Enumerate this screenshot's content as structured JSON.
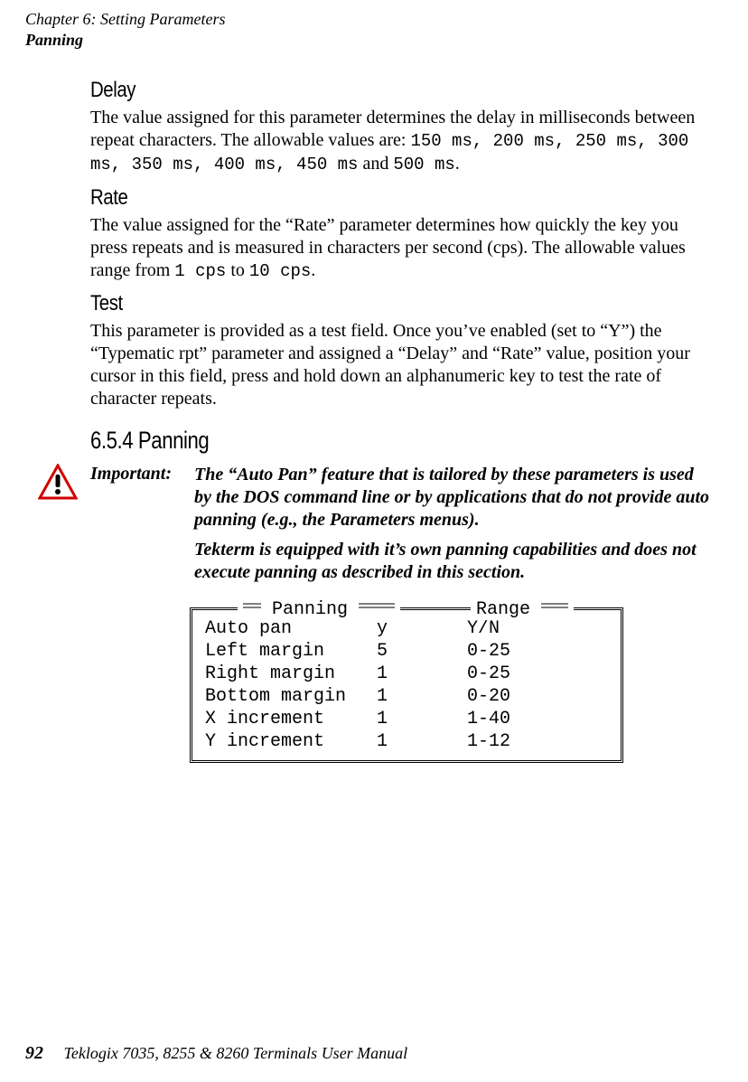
{
  "header": {
    "chapter": "Chapter  6:  Setting Parameters",
    "section": "Panning"
  },
  "delay": {
    "heading": "Delay",
    "body_pre": "The value assigned for this parameter determines the delay in milliseconds between repeat characters. The allowable values are: ",
    "mono1": "150 ms, 200 ms, 250 ms, 300 ms, 350 ms, 400 ms, 450 ms",
    "mid": " and ",
    "mono2": "500 ms",
    "suffix": "."
  },
  "rate": {
    "heading": "Rate",
    "body_pre": "The value assigned for the “Rate” parameter determines how quickly the key you press repeats and is measured in characters per second (cps). The allowable values range from ",
    "mono1": "1 cps",
    "mid": " to ",
    "mono2": "10 cps",
    "suffix": "."
  },
  "test": {
    "heading": "Test",
    "body": "This parameter is provided as a test field. Once you’ve enabled (set to “Y”) the “Typematic rpt” parameter and assigned a “Delay” and “Rate” value, position your cursor in this field, press and hold down an alphanumeric key to test the rate of character repeats."
  },
  "panning": {
    "heading": "6.5.4   Panning",
    "important_label": "Important:",
    "important_p1": "The “Auto Pan” feature that is tailored by these parameters is used by the DOS command line or by applications that do not provide auto panning (e.g., the Parameters menus).",
    "important_p2": "Tekterm is equipped with it’s own panning capabilities and does not execute panning as described in this section.",
    "panel_title": "Panning",
    "range_title": "Range",
    "rows": [
      {
        "name": "Auto pan",
        "value": "y",
        "range": "Y/N"
      },
      {
        "name": "Left margin",
        "value": "5",
        "range": "0-25"
      },
      {
        "name": "Right margin",
        "value": "1",
        "range": "0-25"
      },
      {
        "name": "Bottom margin",
        "value": "1",
        "range": "0-20"
      },
      {
        "name": "X increment",
        "value": "1",
        "range": "1-40"
      },
      {
        "name": "Y increment",
        "value": "1",
        "range": "1-12"
      }
    ]
  },
  "footer": {
    "page_number": "92",
    "manual": "Teklogix 7035, 8255 & 8260 Terminals User Manual"
  }
}
